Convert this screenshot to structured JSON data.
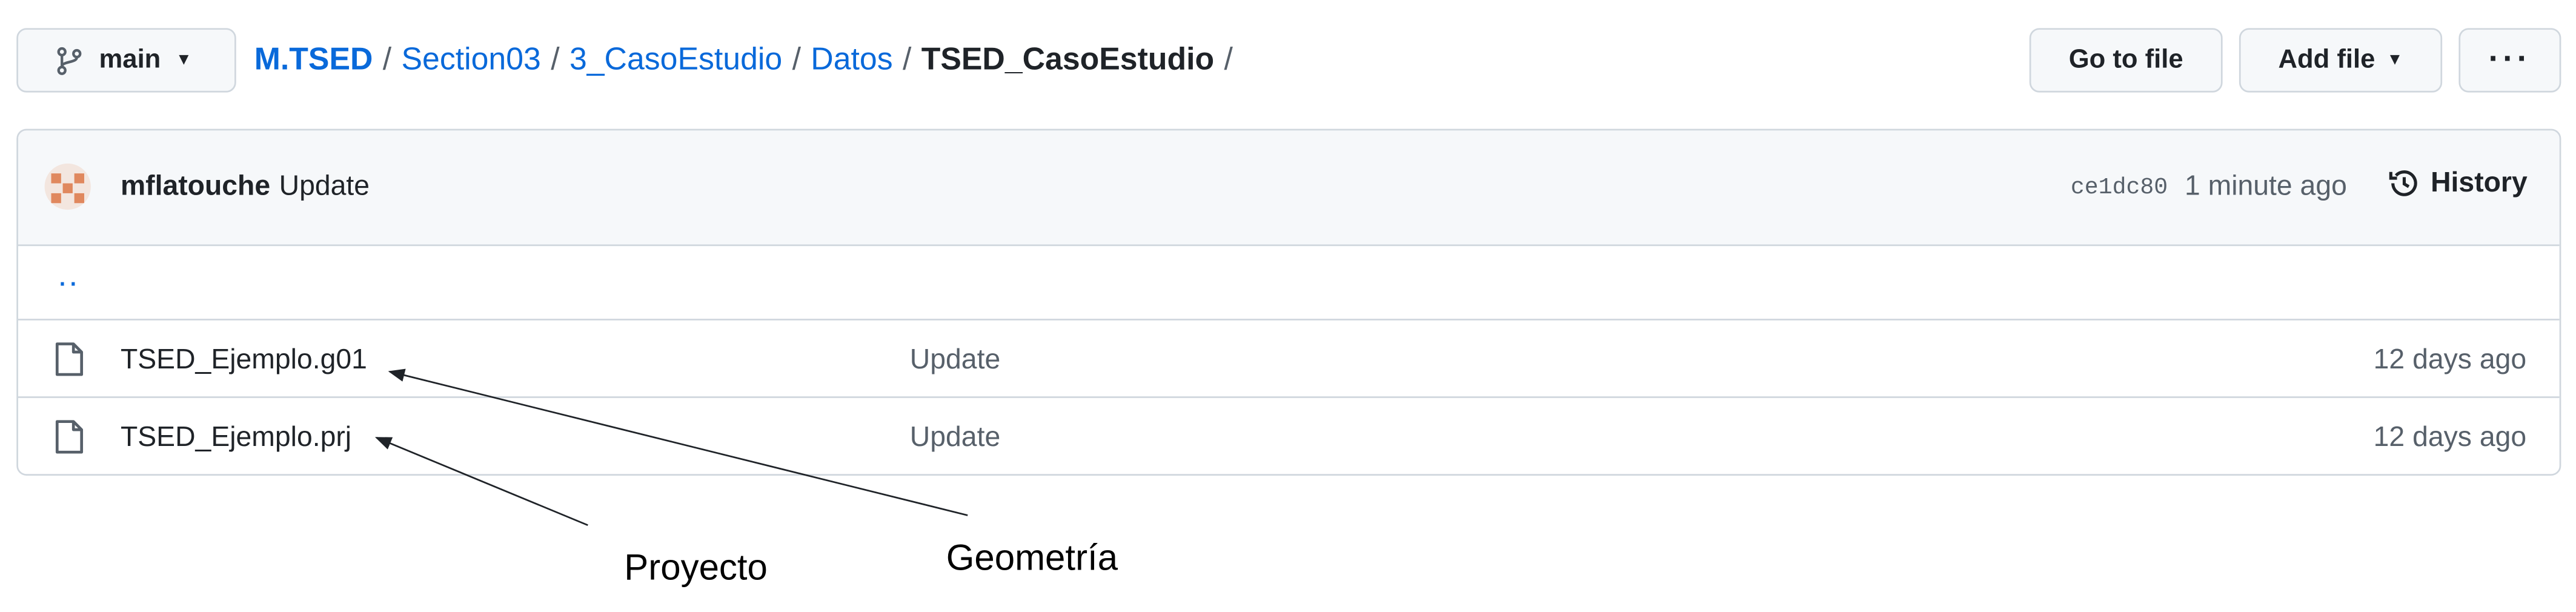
{
  "branch": {
    "name": "main",
    "icon": "git-branch-icon"
  },
  "breadcrumb": {
    "repo": "M.TSED",
    "parts": [
      "Section03",
      "3_CasoEstudio",
      "Datos"
    ],
    "current": "TSED_CasoEstudio",
    "separator": "/"
  },
  "actions": {
    "go_to_file": "Go to file",
    "add_file": "Add file",
    "more": "···"
  },
  "commit": {
    "author": "mflatouche",
    "message": "Update",
    "sha": "ce1dc80",
    "time": "1 minute ago",
    "history_label": "History"
  },
  "parent_dir": "..",
  "files": [
    {
      "name": "TSED_Ejemplo.g01",
      "message": "Update",
      "age": "12 days ago"
    },
    {
      "name": "TSED_Ejemplo.prj",
      "message": "Update",
      "age": "12 days ago"
    }
  ],
  "annotations": {
    "proyecto": "Proyecto",
    "geometria": "Geometría"
  },
  "colors": {
    "link": "#0969da",
    "border": "#d0d7de",
    "header_bg": "#f6f8fa",
    "muted": "#57606a"
  }
}
